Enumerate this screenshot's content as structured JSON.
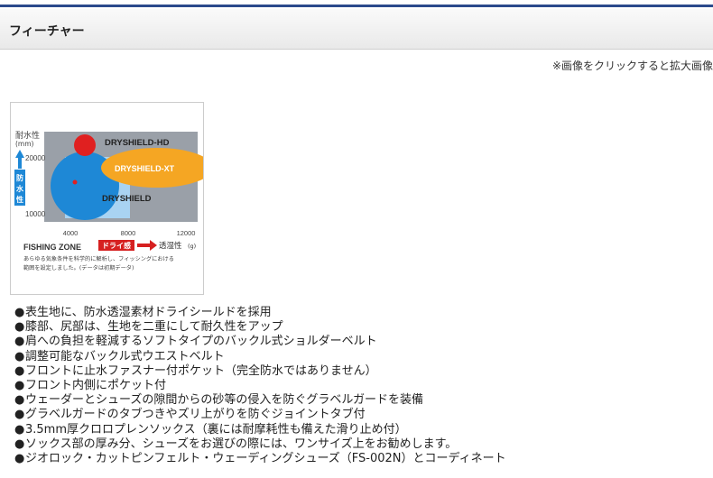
{
  "header": {
    "title": "フィーチャー"
  },
  "note": "※画像をクリックすると拡大画像",
  "figure": {
    "yaxis_title": "耐水性",
    "yaxis_unit": "(mm)",
    "y_ticks": [
      "20000",
      "10000"
    ],
    "x_ticks": [
      "4000",
      "8000",
      "12000"
    ],
    "arrow_label_chars": [
      "防",
      "水",
      "性"
    ],
    "products": [
      "DRYSHIELD-HD",
      "DRYSHIELD-XT",
      "DRYSHIELD"
    ],
    "zone_title": "FISHING ZONE",
    "dry_badge": "ドライ感",
    "xaxis_title": "透湿性",
    "xaxis_unit": "(g)",
    "caption_line1": "あらゆる気象条件を科学的に解析し、フィッシングにおける",
    "caption_line2": "範囲を設定しました。(データは初期データ)"
  },
  "features": [
    "表生地に、防水透湿素材ドライシールドを採用",
    "膝部、尻部は、生地を二重にして耐久性をアップ",
    "肩への負担を軽減するソフトタイプのバックル式ショルダーベルト",
    "調整可能なバックル式ウエストベルト",
    "フロントに止水ファスナー付ポケット（完全防水ではありません）",
    "フロント内側にポケット付",
    "ウェーダーとシューズの隙間からの砂等の侵入を防ぐグラベルガードを装備",
    "グラベルガードのタブつきやズリ上がりを防ぐジョイントタブ付",
    "3.5mm厚クロロプレンソックス（裏には耐摩耗性も備えた滑り止め付）",
    "ソックス部の厚み分、シューズをお選びの際には、ワンサイズ上をお勧めします。",
    "ジオロック・カットピンフェルト・ウェーディングシューズ（FS-002N）とコーディネート"
  ],
  "bullet": "●",
  "colors": {
    "accent": "#2b4a8c",
    "xt": "#f5a623",
    "hd": "#e02020",
    "base": "#1e88d6",
    "zone": "#9aa0a8"
  }
}
